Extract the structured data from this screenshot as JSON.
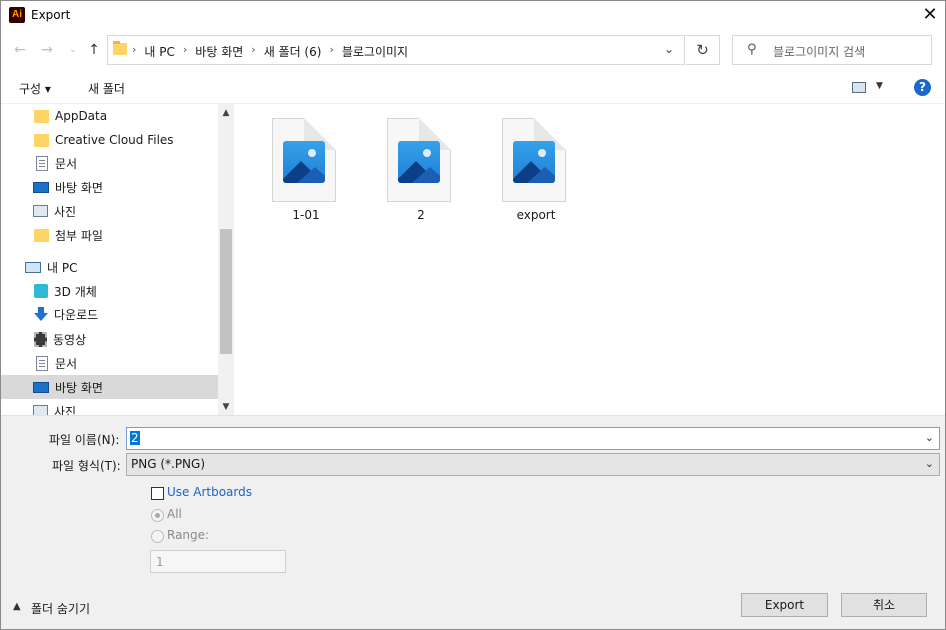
{
  "window": {
    "app_icon": "Ai",
    "title": "Export",
    "close_icon": "✕"
  },
  "address": {
    "crumbs": [
      "내 PC",
      "바탕 화면",
      "새 폴더 (6)",
      "블로그이미지"
    ],
    "search_placeholder": "블로그이미지 검색"
  },
  "toolbar": {
    "organize_label": "구성 ▾",
    "new_folder_label": "새 폴더",
    "help_label": "?"
  },
  "nav": {
    "items": [
      {
        "label": "AppData",
        "icon": "folder-icon"
      },
      {
        "label": "Creative Cloud Files",
        "icon": "folder-icon"
      },
      {
        "label": "문서",
        "icon": "document-icon"
      },
      {
        "label": "바탕 화면",
        "icon": "desktop-icon"
      },
      {
        "label": "사진",
        "icon": "pictures-icon"
      },
      {
        "label": "첨부 파일",
        "icon": "folder-icon"
      },
      {
        "label": "내 PC",
        "icon": "pc-icon"
      },
      {
        "label": "3D 개체",
        "icon": "3d-objects-icon"
      },
      {
        "label": "다운로드",
        "icon": "download-icon"
      },
      {
        "label": "동영상",
        "icon": "video-icon"
      },
      {
        "label": "문서",
        "icon": "document-icon"
      },
      {
        "label": "바탕 화면",
        "icon": "desktop-icon",
        "selected": true
      },
      {
        "label": "사진",
        "icon": "pictures-icon"
      }
    ]
  },
  "files": [
    {
      "name": "1-01",
      "icon": "image-file-icon"
    },
    {
      "name": "2",
      "icon": "image-file-icon"
    },
    {
      "name": "export",
      "icon": "image-file-icon"
    }
  ],
  "form": {
    "filename_label": "파일 이름(N):",
    "filename_value": "2",
    "filetype_label": "파일 형식(T):",
    "filetype_value": "PNG (*.PNG)",
    "use_artboards_label": "Use Artboards",
    "all_label": "All",
    "range_label": "Range:",
    "range_value": "1"
  },
  "footer": {
    "hide_folders_label": "폴더 숨기기",
    "export_button": "Export",
    "cancel_button": "취소"
  },
  "colors": {
    "accent": "#0078d7",
    "link": "#1a66c2",
    "selection": "#d9d9d9",
    "panel": "#f0f0f0"
  }
}
